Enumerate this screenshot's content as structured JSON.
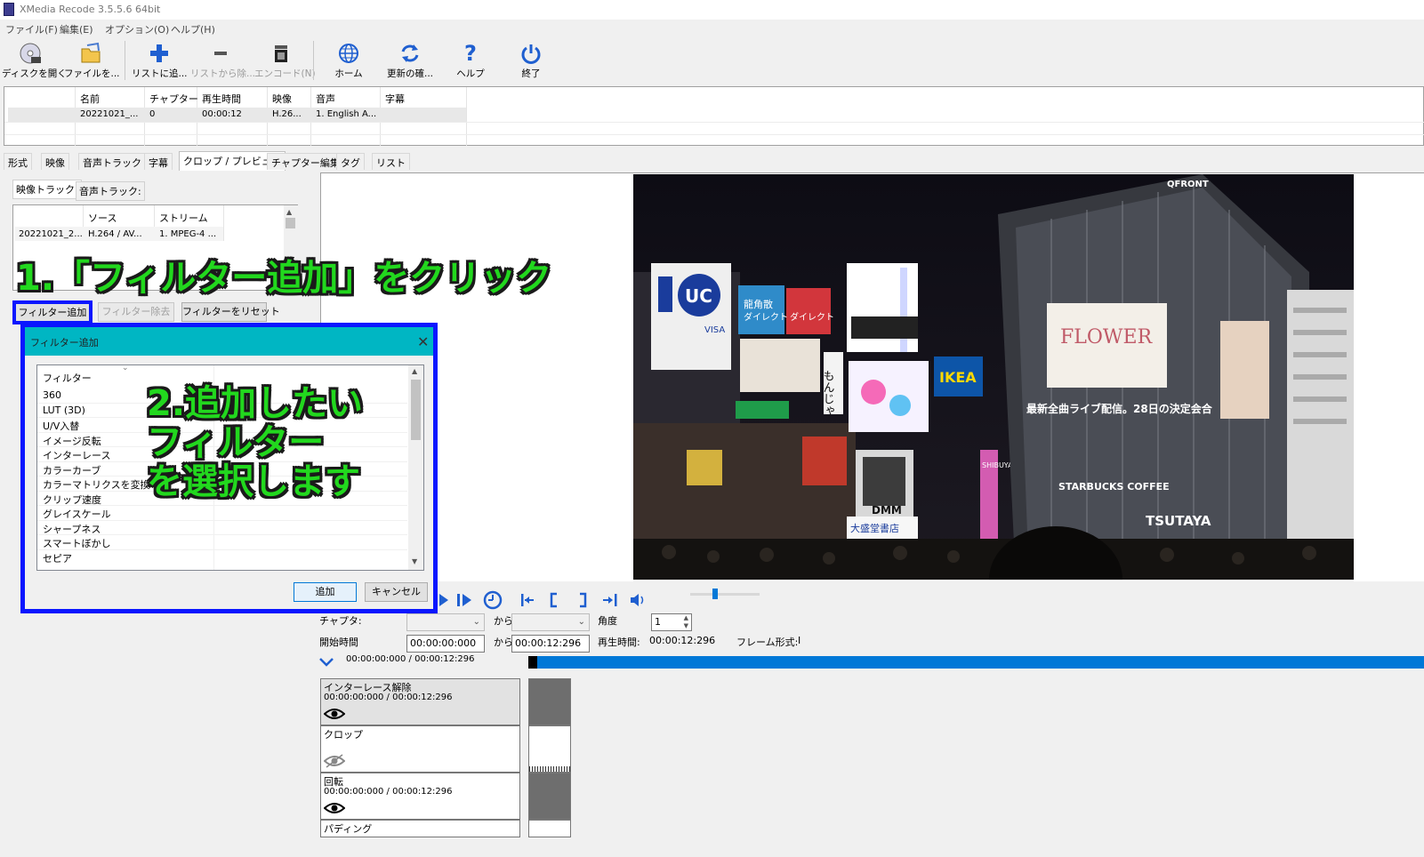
{
  "window": {
    "title": "XMedia Recode 3.5.5.6 64bit"
  },
  "menu": [
    "ファイル(F)",
    "編集(E)",
    "オプション(O)",
    "ヘルプ(H)"
  ],
  "toolbar": {
    "open_disc": "ディスクを開く",
    "open_file": "ファイルを...",
    "add_list": "リストに追...",
    "remove_list": "リストから除...",
    "encode": "エンコード(N)",
    "home": "ホーム",
    "check_update": "更新の確...",
    "help": "ヘルプ",
    "exit": "終了"
  },
  "file_list": {
    "headers": [
      "名前",
      "チャプター",
      "再生時間",
      "映像",
      "音声",
      "字幕"
    ],
    "rows": [
      [
        "20221021_...",
        "0",
        "00:00:12",
        "H.26...",
        "1. English A...",
        ""
      ]
    ]
  },
  "tabs": [
    "形式",
    "映像",
    "音声トラック 1",
    "字幕",
    "クロップ / プレビュー",
    "チャプター編集",
    "タグ",
    "リスト"
  ],
  "left_panel": {
    "video_track_tab": "映像トラック:",
    "audio_track_tab": "音声トラック:",
    "track_headers": [
      "ソース",
      "ストリーム"
    ],
    "track_row": [
      "20221021_2...",
      "H.264 / AV...",
      "1. MPEG-4 ..."
    ],
    "add_filter": "フィルター追加",
    "remove_filter": "フィルター除去",
    "reset_filter": "フィルターをリセット"
  },
  "dialog": {
    "title": "フィルター追加",
    "column": "フィルター",
    "filters": [
      "360",
      "LUT (3D)",
      "U/V入替",
      "イメージ反転",
      "インターレース",
      "カラーカーブ",
      "カラーマトリクスを変換",
      "クリップ速度",
      "グレイスケール",
      "シャープネス",
      "スマートぼかし",
      "セピア"
    ],
    "add": "追加",
    "cancel": "キャンセル"
  },
  "annotations": {
    "step1": "1.「フィルター追加」をクリック",
    "step2_l1": "2.追加したい",
    "step2_l2": "フィルター",
    "step2_l3": "を選択します"
  },
  "preview_signs": {
    "qfront": "QFRONT",
    "uc": "UC",
    "visa": "VISA",
    "ryukaku1": "龍角散",
    "ryukaku2": "ダイレクト",
    "ryukaku3": "ダイレクト",
    "monja": "もんじゃ",
    "ikea": "IKEA",
    "concert": "最新全曲ライブ配信。28日の決定会合",
    "starbucks": "STARBUCKS COFFEE",
    "tsutaya": "TSUTAYA",
    "dmm": "DMM",
    "bigboard": "FLOWER",
    "tsuko": "大盛堂書店",
    "pink": "SHIBUYA"
  },
  "controls": {
    "chapter": "チャプタ:",
    "from1": "から",
    "from2": "から",
    "angle": "角度",
    "angle_value": "1",
    "start_time": "開始時間",
    "start_value": "00:00:00:000",
    "end_value": "00:00:12:296",
    "play_time_label": "再生時間:",
    "play_time_value": "00:00:12:296",
    "frame_type_label": "フレーム形式:",
    "frame_type_value": "I",
    "position": "00:00:00:000 / 00:00:12:296"
  },
  "timeline": [
    {
      "name": "インターレース解除",
      "time": "00:00:00:000 / 00:00:12:296",
      "visible": true
    },
    {
      "name": "クロップ",
      "time": "",
      "visible": false
    },
    {
      "name": "回転",
      "time": "00:00:00:000 / 00:00:12:296",
      "visible": true
    },
    {
      "name": "パディング",
      "time": "",
      "visible": true
    }
  ],
  "colors": {
    "accent": "#0078d7",
    "dialog_title": "#00b6c3",
    "highlight": "#0a16ff",
    "annotation": "#22d81e"
  }
}
